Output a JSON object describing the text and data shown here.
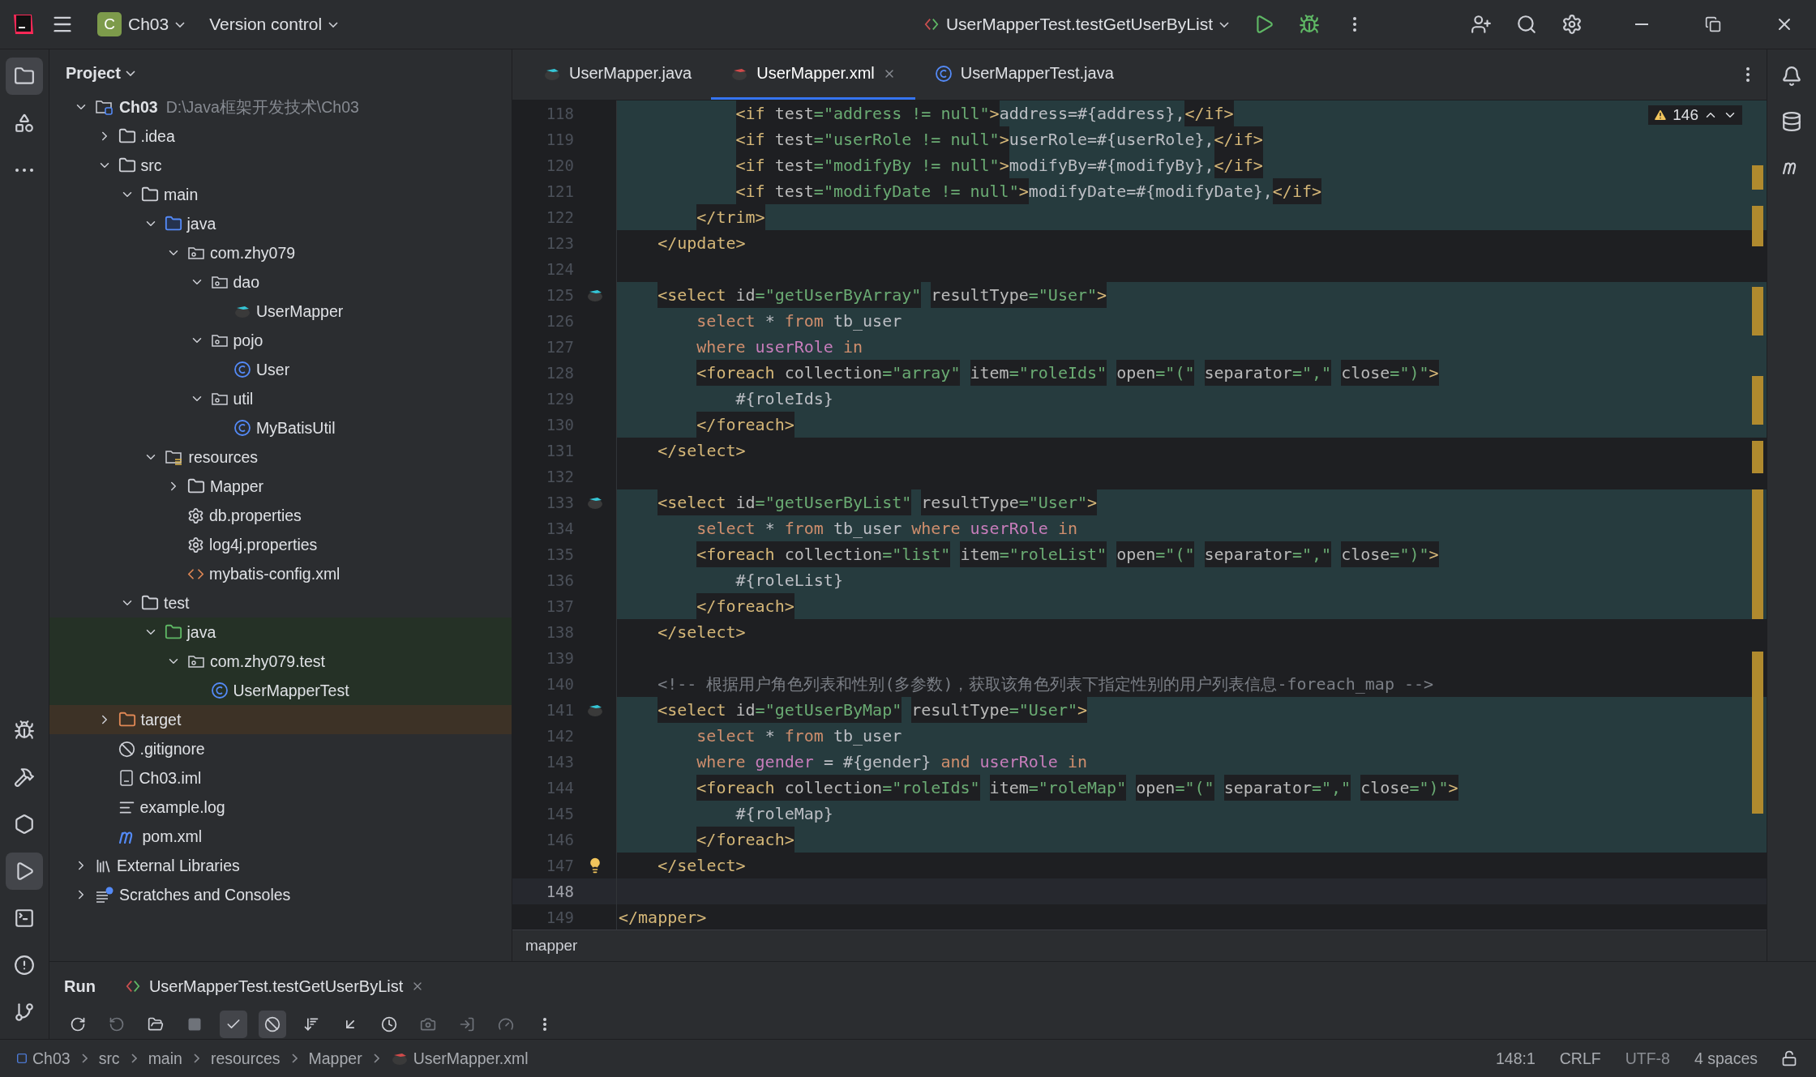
{
  "title_bar": {
    "project_badge": "C",
    "project": "Ch03",
    "vcs": "Version control",
    "run_config": "UserMapperTest.testGetUserByList"
  },
  "left_tools": {
    "top": [
      {
        "kind": "project",
        "selected": true
      },
      {
        "kind": "structure",
        "selected": false
      },
      {
        "kind": "more",
        "selected": false
      }
    ],
    "bottom": [
      {
        "kind": "debug",
        "selected": false
      },
      {
        "kind": "build",
        "selected": false
      },
      {
        "kind": "services",
        "selected": false
      },
      {
        "kind": "run",
        "selected": true
      },
      {
        "kind": "terminal",
        "selected": false
      },
      {
        "kind": "problems",
        "selected": false
      },
      {
        "kind": "git",
        "selected": false
      }
    ]
  },
  "project": {
    "title": "Project",
    "tree": [
      {
        "label": "Ch03",
        "hint": "D:\\Java框架开发技术\\Ch03",
        "kind": "module",
        "expanded": true,
        "children": [
          {
            "label": ".idea",
            "kind": "folder",
            "expanded": false
          },
          {
            "label": "src",
            "kind": "folder",
            "expanded": true,
            "children": [
              {
                "label": "main",
                "kind": "folder",
                "expanded": true,
                "children": [
                  {
                    "label": "java",
                    "kind": "source",
                    "expanded": true,
                    "children": [
                      {
                        "label": "com.zhy079",
                        "kind": "package",
                        "expanded": true,
                        "children": [
                          {
                            "label": "dao",
                            "kind": "package",
                            "expanded": true,
                            "children": [
                              {
                                "label": "UserMapper",
                                "kind": "mapper"
                              }
                            ]
                          },
                          {
                            "label": "pojo",
                            "kind": "package",
                            "expanded": true,
                            "children": [
                              {
                                "label": "User",
                                "kind": "class"
                              }
                            ]
                          },
                          {
                            "label": "util",
                            "kind": "package",
                            "expanded": true,
                            "children": [
                              {
                                "label": "MyBatisUtil",
                                "kind": "class"
                              }
                            ]
                          }
                        ]
                      }
                    ]
                  },
                  {
                    "label": "resources",
                    "kind": "resources",
                    "expanded": true,
                    "children": [
                      {
                        "label": "Mapper",
                        "kind": "folder",
                        "expanded": false
                      },
                      {
                        "label": "db.properties",
                        "kind": "properties"
                      },
                      {
                        "label": "log4j.properties",
                        "kind": "properties"
                      },
                      {
                        "label": "mybatis-config.xml",
                        "kind": "xml"
                      }
                    ]
                  }
                ]
              },
              {
                "label": "test",
                "kind": "folder",
                "expanded": true,
                "children": [
                  {
                    "label": "java",
                    "kind": "test-root",
                    "expanded": true,
                    "children": [
                      {
                        "label": "com.zhy079.test",
                        "kind": "package",
                        "expanded": true,
                        "children": [
                          {
                            "label": "UserMapperTest",
                            "kind": "class"
                          }
                        ]
                      }
                    ]
                  }
                ]
              }
            ]
          },
          {
            "label": "target",
            "kind": "excluded",
            "expanded": false
          },
          {
            "label": ".gitignore",
            "kind": "ignore"
          },
          {
            "label": "Ch03.iml",
            "kind": "iml"
          },
          {
            "label": "example.log",
            "kind": "log"
          },
          {
            "label": "pom.xml",
            "kind": "maven"
          }
        ]
      },
      {
        "label": "External Libraries",
        "kind": "libraries",
        "expanded": false
      },
      {
        "label": "Scratches and Consoles",
        "kind": "scratches",
        "expanded": false
      }
    ]
  },
  "tabs": [
    {
      "label": "UserMapper.java",
      "kind": "mapper",
      "selected": false
    },
    {
      "label": "UserMapper.xml",
      "kind": "mapper-xml",
      "selected": true
    },
    {
      "label": "UserMapperTest.java",
      "kind": "class",
      "selected": false
    }
  ],
  "editor": {
    "warnings": "146",
    "lines": [
      {
        "n": "118",
        "injected": true,
        "tokens": [
          {
            "kind": "tag",
            "text": "            <if "
          },
          {
            "kind": "attr",
            "text": "test"
          },
          {
            "kind": "str",
            "text": "=\"address != null\""
          },
          {
            "kind": "tag",
            "text": ">"
          },
          {
            "kind": "text",
            "text": "address=#{address},"
          },
          {
            "kind": "tag",
            "text": "</if>"
          }
        ]
      },
      {
        "n": "119",
        "injected": true,
        "tokens": [
          {
            "kind": "tag",
            "text": "            <if "
          },
          {
            "kind": "attr",
            "text": "test"
          },
          {
            "kind": "str",
            "text": "=\"userRole != null\""
          },
          {
            "kind": "tag",
            "text": ">"
          },
          {
            "kind": "text",
            "text": "userRole=#{userRole},"
          },
          {
            "kind": "tag",
            "text": "</if>"
          }
        ]
      },
      {
        "n": "120",
        "injected": true,
        "tokens": [
          {
            "kind": "tag",
            "text": "            <if "
          },
          {
            "kind": "attr",
            "text": "test"
          },
          {
            "kind": "str",
            "text": "=\"modifyBy != null\""
          },
          {
            "kind": "tag",
            "text": ">"
          },
          {
            "kind": "text",
            "text": "modifyBy=#{modifyBy},"
          },
          {
            "kind": "tag",
            "text": "</if>"
          }
        ]
      },
      {
        "n": "121",
        "injected": true,
        "tokens": [
          {
            "kind": "tag",
            "text": "            <if "
          },
          {
            "kind": "attr",
            "text": "test"
          },
          {
            "kind": "str",
            "text": "=\"modifyDate != null\""
          },
          {
            "kind": "tag",
            "text": ">"
          },
          {
            "kind": "text",
            "text": "modifyDate=#{modifyDate},"
          },
          {
            "kind": "tag",
            "text": "</if>"
          }
        ]
      },
      {
        "n": "122",
        "injected": true,
        "tokens": [
          {
            "kind": "tag",
            "text": "        </trim>"
          }
        ]
      },
      {
        "n": "123",
        "injected": false,
        "tokens": [
          {
            "kind": "tag",
            "text": "    </update>"
          }
        ]
      },
      {
        "n": "124",
        "injected": false
      },
      {
        "n": "125",
        "injected": true,
        "gutter": {
          "kind": "mapper"
        },
        "tokens": [
          {
            "kind": "tag",
            "text": "    <select "
          },
          {
            "kind": "attr",
            "text": "id"
          },
          {
            "kind": "str",
            "text": "=\"getUserByArray\""
          },
          {
            "kind": "attr",
            "text": " resultType"
          },
          {
            "kind": "str",
            "text": "=\"User\""
          },
          {
            "kind": "tag",
            "text": ">"
          }
        ]
      },
      {
        "n": "126",
        "injected": true,
        "tokens": [
          {
            "kind": "kw",
            "text": "        select"
          },
          {
            "kind": "text",
            "text": " * "
          },
          {
            "kind": "kw",
            "text": "from"
          },
          {
            "kind": "text",
            "text": " tb_user"
          }
        ]
      },
      {
        "n": "127",
        "injected": true,
        "tokens": [
          {
            "kind": "kw",
            "text": "        where "
          },
          {
            "kind": "param",
            "text": "userRole"
          },
          {
            "kind": "kw",
            "text": " in"
          }
        ]
      },
      {
        "n": "128",
        "injected": true,
        "tokens": [
          {
            "kind": "tag",
            "text": "        <foreach "
          },
          {
            "kind": "attr",
            "text": "collection"
          },
          {
            "kind": "str",
            "text": "=\"array\""
          },
          {
            "kind": "attr",
            "text": " item"
          },
          {
            "kind": "str",
            "text": "=\"roleIds\""
          },
          {
            "kind": "attr",
            "text": " open"
          },
          {
            "kind": "str",
            "text": "=\"(\""
          },
          {
            "kind": "attr",
            "text": " separator"
          },
          {
            "kind": "str",
            "text": "=\",\""
          },
          {
            "kind": "attr",
            "text": " close"
          },
          {
            "kind": "str",
            "text": "=\")\""
          },
          {
            "kind": "tag",
            "text": ">"
          }
        ]
      },
      {
        "n": "129",
        "injected": true,
        "tokens": [
          {
            "kind": "text",
            "text": "            #{roleIds}"
          }
        ]
      },
      {
        "n": "130",
        "injected": true,
        "tokens": [
          {
            "kind": "tag",
            "text": "        </foreach>"
          }
        ]
      },
      {
        "n": "131",
        "injected": false,
        "tokens": [
          {
            "kind": "tag",
            "text": "    </select>"
          }
        ]
      },
      {
        "n": "132",
        "injected": false
      },
      {
        "n": "133",
        "injected": true,
        "gutter": {
          "kind": "mapper"
        },
        "tokens": [
          {
            "kind": "tag",
            "text": "    <select "
          },
          {
            "kind": "attr",
            "text": "id"
          },
          {
            "kind": "str",
            "text": "=\"getUserByList\""
          },
          {
            "kind": "attr",
            "text": " resultType"
          },
          {
            "kind": "str",
            "text": "=\"User\""
          },
          {
            "kind": "tag",
            "text": ">"
          }
        ]
      },
      {
        "n": "134",
        "injected": true,
        "tokens": [
          {
            "kind": "kw",
            "text": "        select"
          },
          {
            "kind": "text",
            "text": " * "
          },
          {
            "kind": "kw",
            "text": "from"
          },
          {
            "kind": "text",
            "text": " tb_user "
          },
          {
            "kind": "kw",
            "text": "where "
          },
          {
            "kind": "param",
            "text": "userRole"
          },
          {
            "kind": "kw",
            "text": " in"
          }
        ]
      },
      {
        "n": "135",
        "injected": true,
        "tokens": [
          {
            "kind": "tag",
            "text": "        <foreach "
          },
          {
            "kind": "attr",
            "text": "collection"
          },
          {
            "kind": "str",
            "text": "=\"list\""
          },
          {
            "kind": "attr",
            "text": " item"
          },
          {
            "kind": "str",
            "text": "=\"roleList\""
          },
          {
            "kind": "attr",
            "text": " open"
          },
          {
            "kind": "str",
            "text": "=\"(\""
          },
          {
            "kind": "attr",
            "text": " separator"
          },
          {
            "kind": "str",
            "text": "=\",\""
          },
          {
            "kind": "attr",
            "text": " close"
          },
          {
            "kind": "str",
            "text": "=\")\""
          },
          {
            "kind": "tag",
            "text": ">"
          }
        ]
      },
      {
        "n": "136",
        "injected": true,
        "tokens": [
          {
            "kind": "text",
            "text": "            #{roleList}"
          }
        ]
      },
      {
        "n": "137",
        "injected": true,
        "tokens": [
          {
            "kind": "tag",
            "text": "        </foreach>"
          }
        ]
      },
      {
        "n": "138",
        "injected": false,
        "tokens": [
          {
            "kind": "tag",
            "text": "    </select>"
          }
        ]
      },
      {
        "n": "139",
        "injected": false
      },
      {
        "n": "140",
        "injected": false,
        "tokens": [
          {
            "kind": "comment",
            "text": "    <!-- 根据用户角色列表和性别(多参数)，获取该角色列表下指定性别的用户列表信息-foreach_map -->"
          }
        ]
      },
      {
        "n": "141",
        "injected": true,
        "gutter": {
          "kind": "mapper"
        },
        "tokens": [
          {
            "kind": "tag",
            "text": "    <select "
          },
          {
            "kind": "attr",
            "text": "id"
          },
          {
            "kind": "str",
            "text": "=\"getUserByMap\""
          },
          {
            "kind": "attr",
            "text": " resultType"
          },
          {
            "kind": "str",
            "text": "=\"User\""
          },
          {
            "kind": "tag",
            "text": ">"
          }
        ]
      },
      {
        "n": "142",
        "injected": true,
        "tokens": [
          {
            "kind": "kw",
            "text": "        select"
          },
          {
            "kind": "text",
            "text": " * "
          },
          {
            "kind": "kw",
            "text": "from"
          },
          {
            "kind": "text",
            "text": " tb_user"
          }
        ]
      },
      {
        "n": "143",
        "injected": true,
        "tokens": [
          {
            "kind": "kw",
            "text": "        where "
          },
          {
            "kind": "param",
            "text": "gender"
          },
          {
            "kind": "text",
            "text": " = #{gender} "
          },
          {
            "kind": "kw",
            "text": "and "
          },
          {
            "kind": "param",
            "text": "userRole"
          },
          {
            "kind": "kw",
            "text": " in"
          }
        ]
      },
      {
        "n": "144",
        "injected": true,
        "tokens": [
          {
            "kind": "tag",
            "text": "        <foreach "
          },
          {
            "kind": "attr",
            "text": "collection"
          },
          {
            "kind": "str",
            "text": "=\"roleIds\""
          },
          {
            "kind": "attr",
            "text": " item"
          },
          {
            "kind": "str",
            "text": "=\"roleMap\""
          },
          {
            "kind": "attr",
            "text": " open"
          },
          {
            "kind": "str",
            "text": "=\"(\""
          },
          {
            "kind": "attr",
            "text": " separator"
          },
          {
            "kind": "str",
            "text": "=\",\""
          },
          {
            "kind": "attr",
            "text": " close"
          },
          {
            "kind": "str",
            "text": "=\")\""
          },
          {
            "kind": "tag",
            "text": ">"
          }
        ]
      },
      {
        "n": "145",
        "injected": true,
        "tokens": [
          {
            "kind": "text",
            "text": "            #{roleMap}"
          }
        ]
      },
      {
        "n": "146",
        "injected": true,
        "tokens": [
          {
            "kind": "tag",
            "text": "        </foreach>"
          }
        ]
      },
      {
        "n": "147",
        "injected": false,
        "gutter": {
          "kind": "bulb"
        },
        "tokens": [
          {
            "kind": "tag",
            "text": "    </select>"
          }
        ]
      },
      {
        "n": "148",
        "injected": false,
        "current": true
      },
      {
        "n": "149",
        "injected": false,
        "tokens": [
          {
            "kind": "tag",
            "text": "</mapper>"
          }
        ]
      }
    ],
    "breadcrumb": "mapper"
  },
  "run_panel": {
    "title": "Run",
    "tab": "UserMapperTest.testGetUserByList"
  },
  "status_bar": {
    "path": [
      {
        "label": "Ch03",
        "kind": "module"
      },
      {
        "label": "src",
        "kind": "folder"
      },
      {
        "label": "main",
        "kind": "folder"
      },
      {
        "label": "resources",
        "kind": "folder"
      },
      {
        "label": "Mapper",
        "kind": "folder"
      },
      {
        "label": "UserMapper.xml",
        "kind": "mapper-xml"
      }
    ],
    "position": "148:1",
    "line_sep": "CRLF",
    "encoding": "UTF-8",
    "indent": "4 spaces"
  }
}
